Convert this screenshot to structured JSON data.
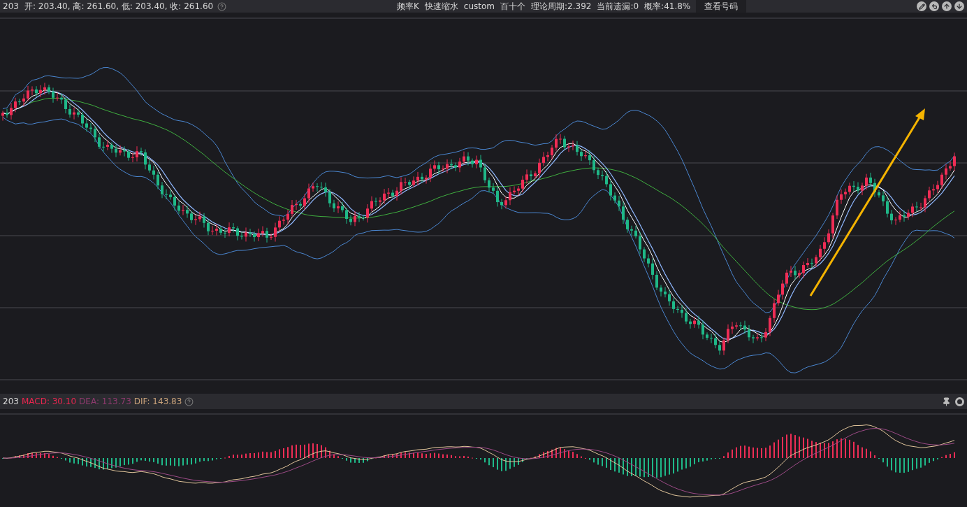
{
  "top_bar": {
    "symbol": "203",
    "ohlc": "开: 203.40, 高: 261.60, 低: 203.40, 收: 261.60",
    "info_items": [
      "频率K",
      "快速缩水",
      "custom",
      "百十个",
      "理论周期:2.392",
      "当前遗漏:0",
      "概率:41.8%"
    ],
    "button": "查看号码"
  },
  "macd_bar": {
    "symbol": "203",
    "indicators": [
      {
        "text": "MACD: 30.10",
        "color": "#e8264f"
      },
      {
        "text": "DEA: 113.73",
        "color": "#8e3a6e"
      },
      {
        "text": "DIF: 143.83",
        "color": "#c9a27a"
      }
    ]
  }
}
